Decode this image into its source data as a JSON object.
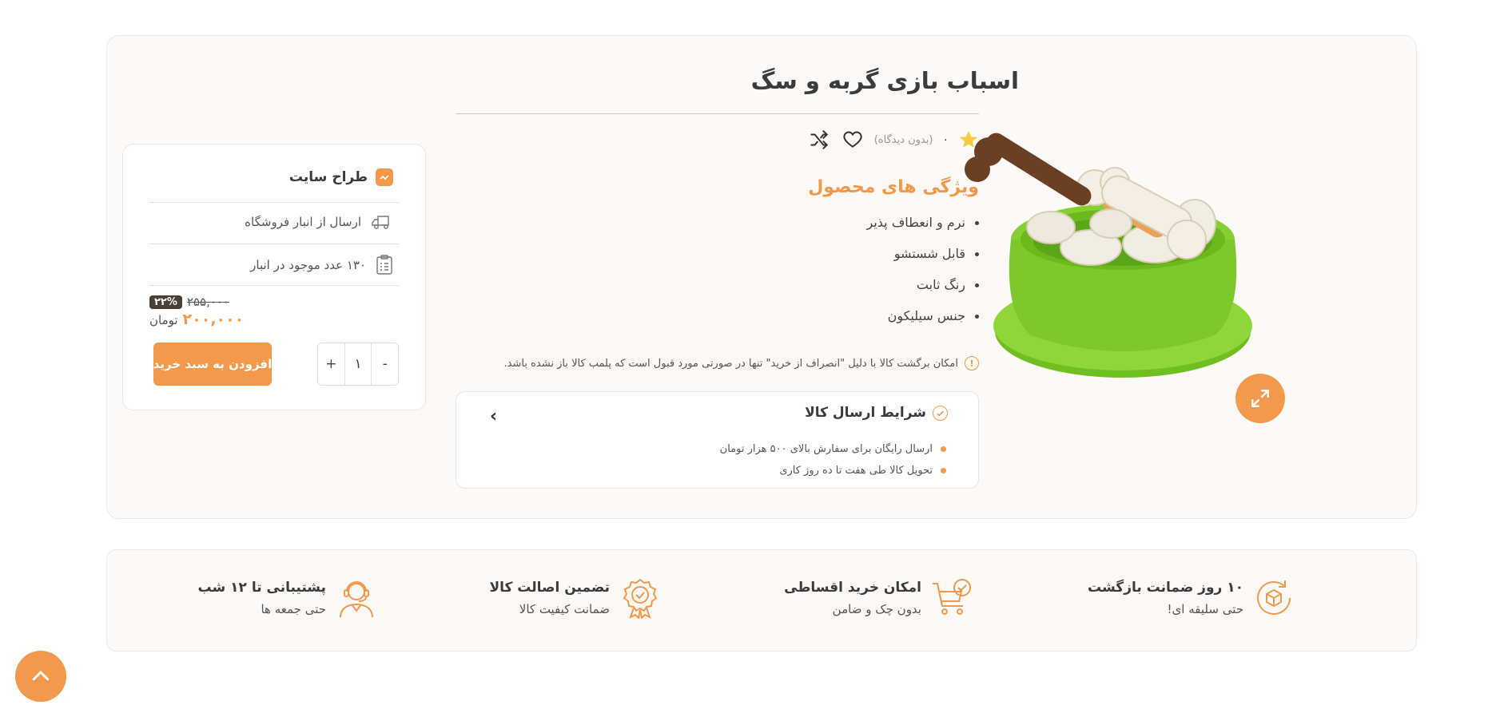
{
  "colors": {
    "accent": "#f3994b",
    "dark": "#3b3b3b",
    "panel": "#fcf9f6"
  },
  "product": {
    "title": "اسباب بازی گربه و سگ",
    "rating_score": "۰",
    "reviews_label": "(بدون دیدگاه)",
    "features_title": "ویژگی های محصول",
    "features": [
      "نرم و انعطاف پذیر",
      "قابل شستشو",
      "رنگ ثابت",
      "جنس سیلیکون"
    ],
    "return_note": "امکان برگشت کالا با دلیل \"انصراف از خرید\" تنها در صورتی مورد قبول است که پلمب کالا باز نشده باشد.",
    "shipping": {
      "title": "شرایط ارسال کالا",
      "items": [
        "ارسال رایگان برای سفارش بالای ۵۰۰ هزار تومان",
        "تحویل کالا طی هفت تا ده روز کاری"
      ]
    }
  },
  "buy_box": {
    "seller": "طراح سایت",
    "shipping_from": "ارسال از انبار فروشگاه",
    "stock": "۱۳۰ عدد موجود در انبار",
    "discount": "۲۲%",
    "old_price": "۲۵۵,۰۰۰",
    "new_price": "۲۰۰,۰۰۰",
    "currency": "تومان",
    "qty_minus": "-",
    "qty_value": "۱",
    "qty_plus": "+",
    "add_to_cart": "افزودن به سبد خرید"
  },
  "services": [
    {
      "title": "۱۰ روز ضمانت بازگشت",
      "subtitle": "حتی سلیقه ای!",
      "icon": "box-return-icon"
    },
    {
      "title": "امکان خرید اقساطی",
      "subtitle": "بدون چک و ضامن",
      "icon": "cart-check-icon"
    },
    {
      "title": "تضمین اصالت کالا",
      "subtitle": "ضمانت کیفیت کالا",
      "icon": "badge-check-icon"
    },
    {
      "title": "پشتیبانی تا ۱۲ شب",
      "subtitle": "حتی جمعه ها",
      "icon": "support-agent-icon"
    }
  ]
}
